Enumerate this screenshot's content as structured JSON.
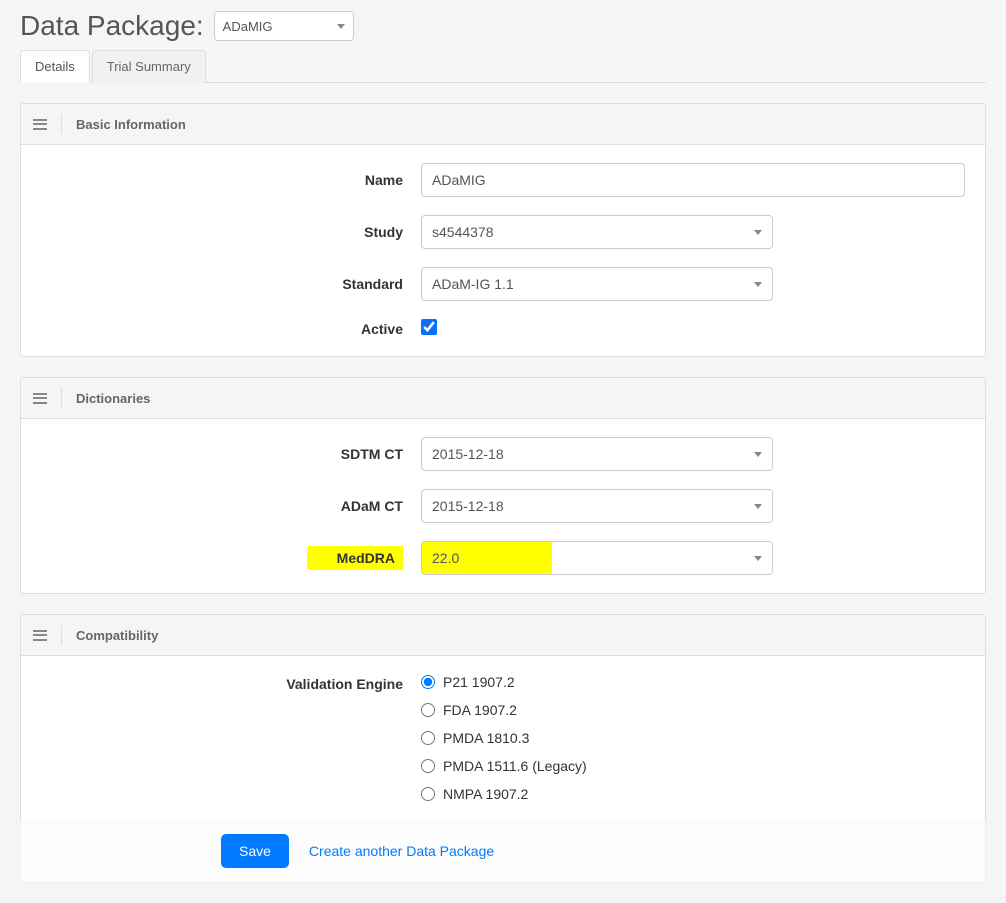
{
  "header": {
    "title": "Data Package:",
    "package_selected": "ADaMIG"
  },
  "tabs": {
    "details": "Details",
    "trial_summary": "Trial Summary"
  },
  "sections": {
    "basic_info": {
      "title": "Basic Information",
      "name_label": "Name",
      "name_value": "ADaMIG",
      "study_label": "Study",
      "study_value": "s4544378",
      "standard_label": "Standard",
      "standard_value": "ADaM-IG 1.1",
      "active_label": "Active",
      "active_checked": true
    },
    "dictionaries": {
      "title": "Dictionaries",
      "sdtm_ct_label": "SDTM CT",
      "sdtm_ct_value": "2015-12-18",
      "adam_ct_label": "ADaM CT",
      "adam_ct_value": "2015-12-18",
      "meddra_label": "MedDRA",
      "meddra_value": "22.0"
    },
    "compatibility": {
      "title": "Compatibility",
      "engine_label": "Validation Engine",
      "options": [
        "P21 1907.2",
        "FDA 1907.2",
        "PMDA 1810.3",
        "PMDA 1511.6 (Legacy)",
        "NMPA 1907.2"
      ],
      "selected": "P21 1907.2"
    }
  },
  "actions": {
    "save": "Save",
    "create_another": "Create another Data Package"
  }
}
